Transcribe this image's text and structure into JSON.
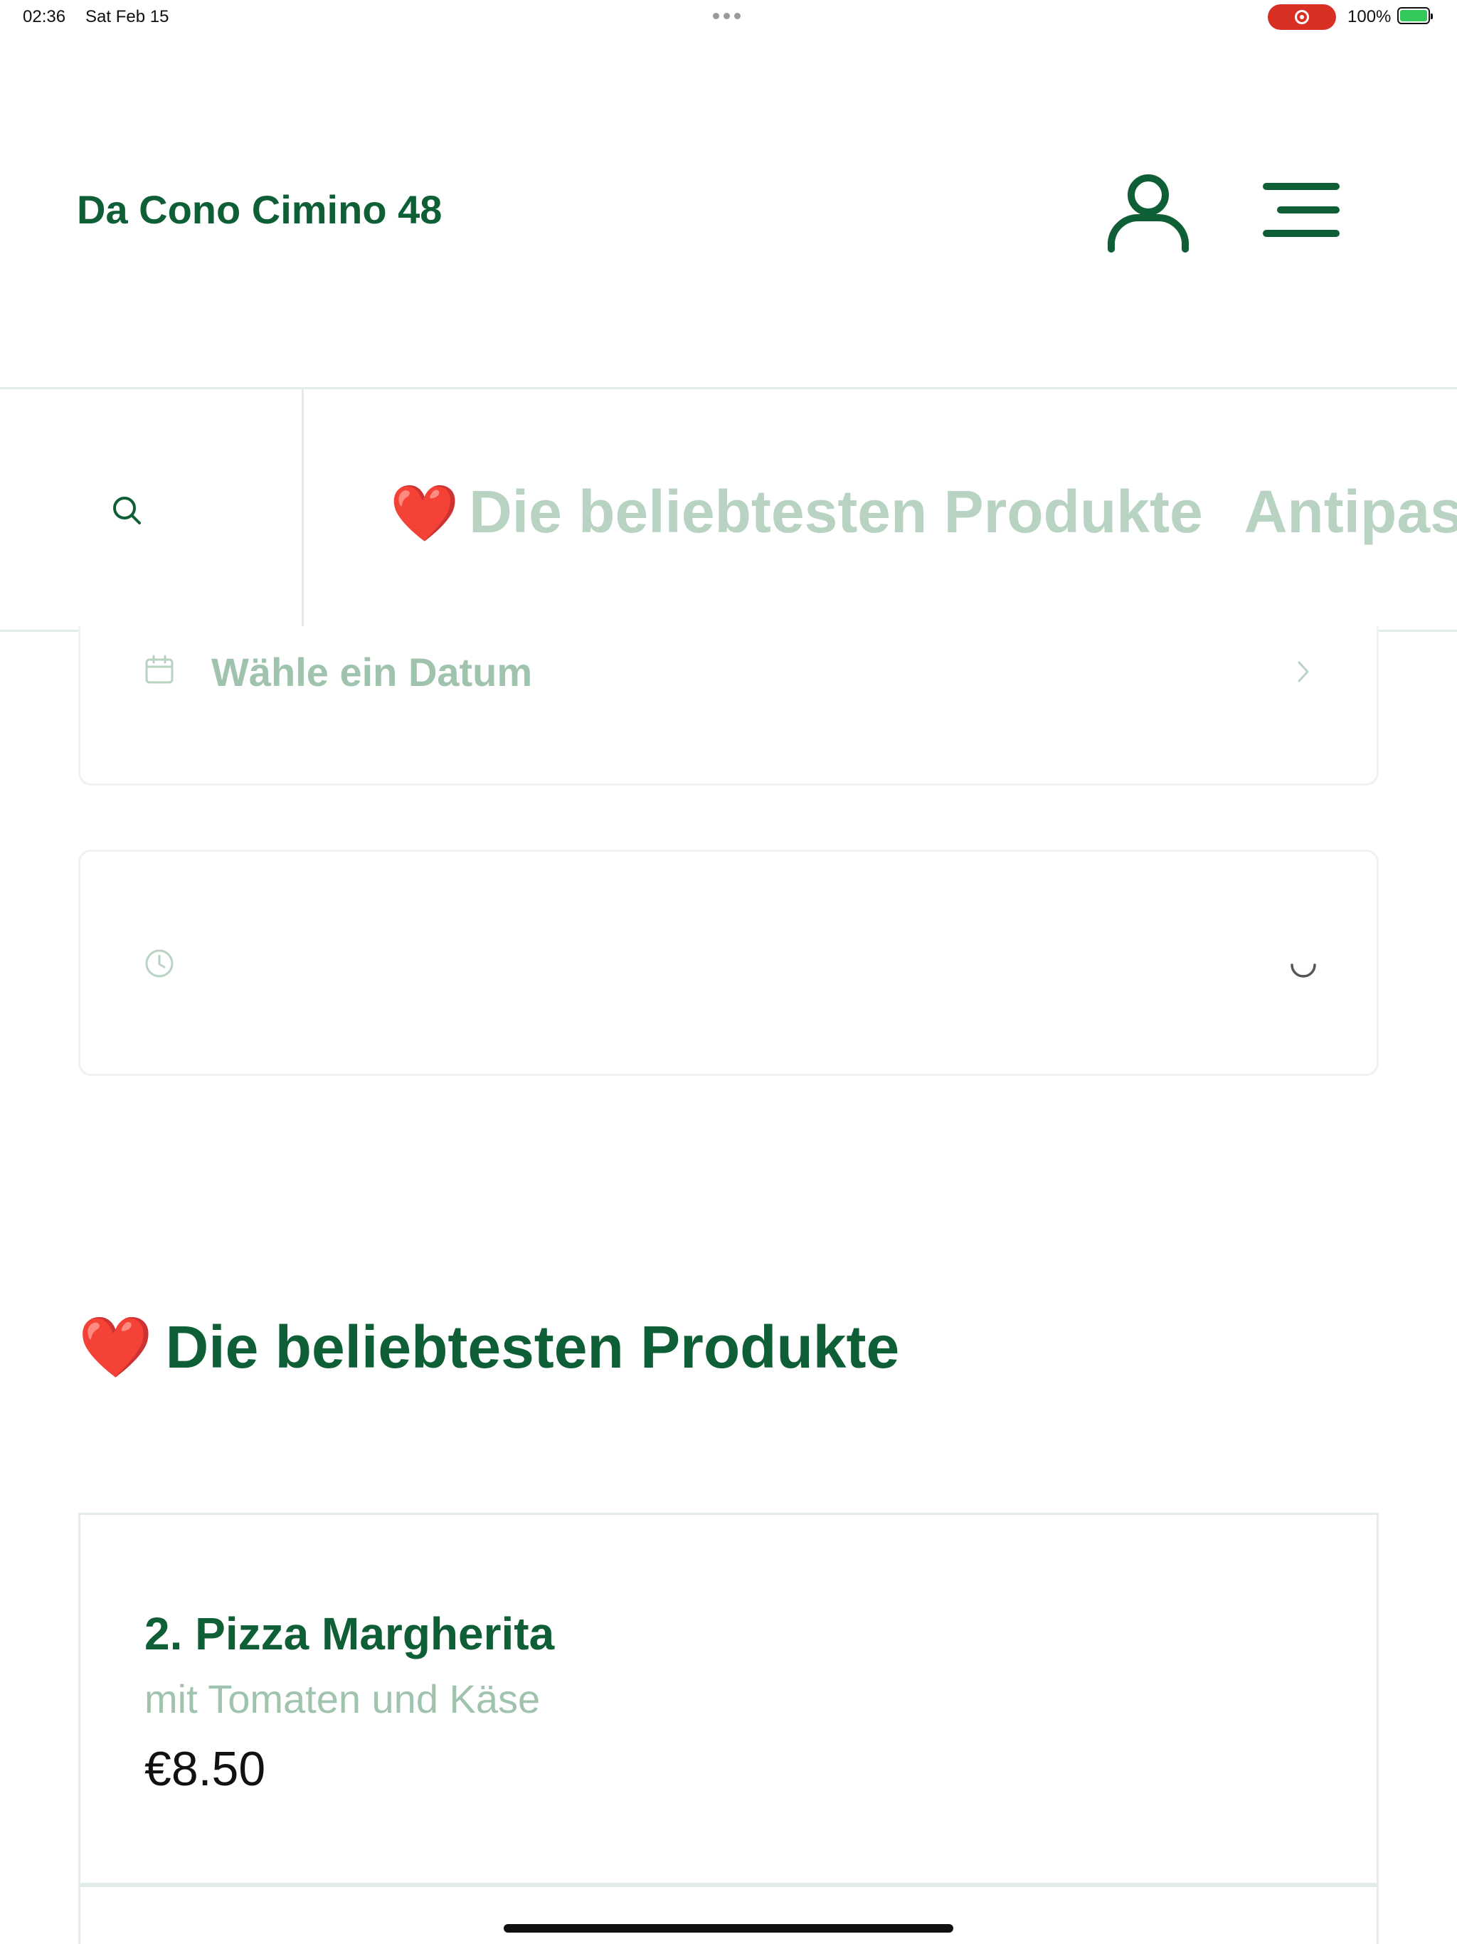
{
  "status_bar": {
    "time": "02:36",
    "date": "Sat Feb 15",
    "battery": "100%"
  },
  "header": {
    "brand": "Da Cono Cimino 48",
    "icons": [
      "user-icon",
      "menu-icon"
    ]
  },
  "categories": {
    "search_icon": "search-icon",
    "items": [
      {
        "emoji": "❤️",
        "label": "Die beliebtesten Produkte"
      },
      {
        "label": "Antipas"
      }
    ]
  },
  "date_picker": {
    "icon": "calendar-icon",
    "label": "Wähle ein Datum"
  },
  "time_picker": {
    "icon": "clock-icon"
  },
  "section": {
    "emoji": "❤️",
    "title": "Die beliebtesten Produkte"
  },
  "products": [
    {
      "name": "2. Pizza Margherita",
      "description": "mit Tomaten und Käse",
      "price": "€8.50"
    }
  ],
  "colors": {
    "brand_green": "#0e5e36",
    "muted_green": "#9fc3ad",
    "tab_inactive": "#b9d3c3",
    "border": "#e4ece7"
  }
}
